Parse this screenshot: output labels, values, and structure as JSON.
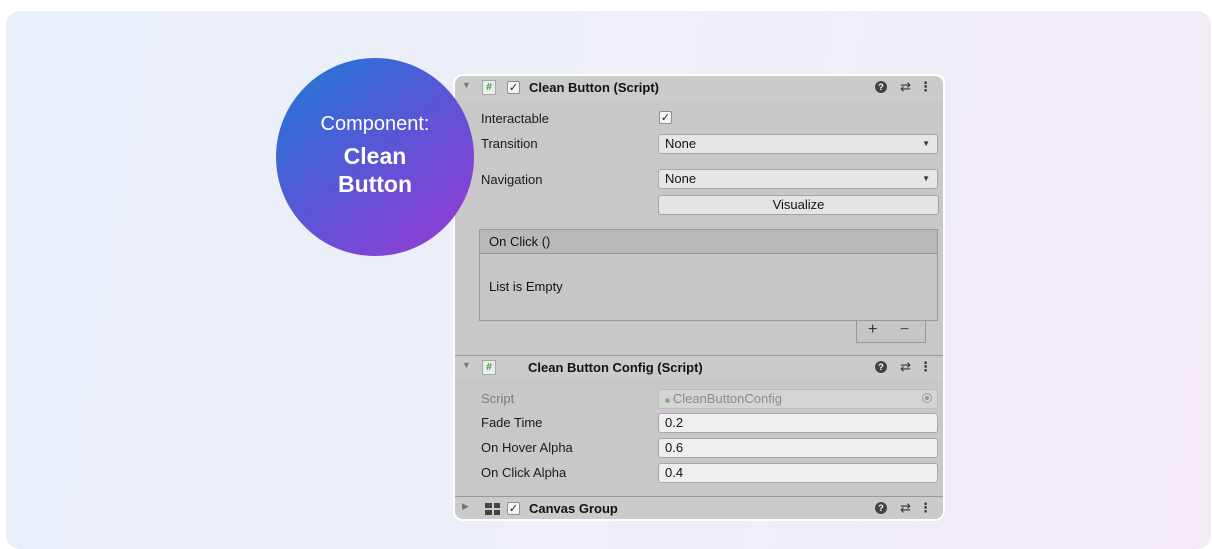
{
  "badge": {
    "line1": "Component:",
    "line2": "Clean Button"
  },
  "inspector": {
    "clean_button": {
      "title": "Clean Button (Script)",
      "enabled": true,
      "interactable_label": "Interactable",
      "interactable_checked": true,
      "transition_label": "Transition",
      "transition_value": "None",
      "navigation_label": "Navigation",
      "navigation_value": "None",
      "visualize_label": "Visualize",
      "on_click_label": "On Click ()",
      "list_empty_text": "List is Empty",
      "add_label": "+",
      "remove_label": "−"
    },
    "config": {
      "title": "Clean Button Config (Script)",
      "script_label": "Script",
      "script_value": "CleanButtonConfig",
      "fade_time_label": "Fade Time",
      "fade_time_value": "0.2",
      "hover_alpha_label": "On Hover Alpha",
      "hover_alpha_value": "0.6",
      "click_alpha_label": "On Click Alpha",
      "click_alpha_value": "0.4"
    },
    "canvas_group": {
      "title": "Canvas Group",
      "enabled": true
    },
    "icons": {
      "expanded": "▼",
      "collapsed": "▶",
      "script": "#",
      "check": "✓",
      "help": "?",
      "presets": "⇄",
      "menu": "⋮",
      "dropdown": "▼"
    }
  }
}
